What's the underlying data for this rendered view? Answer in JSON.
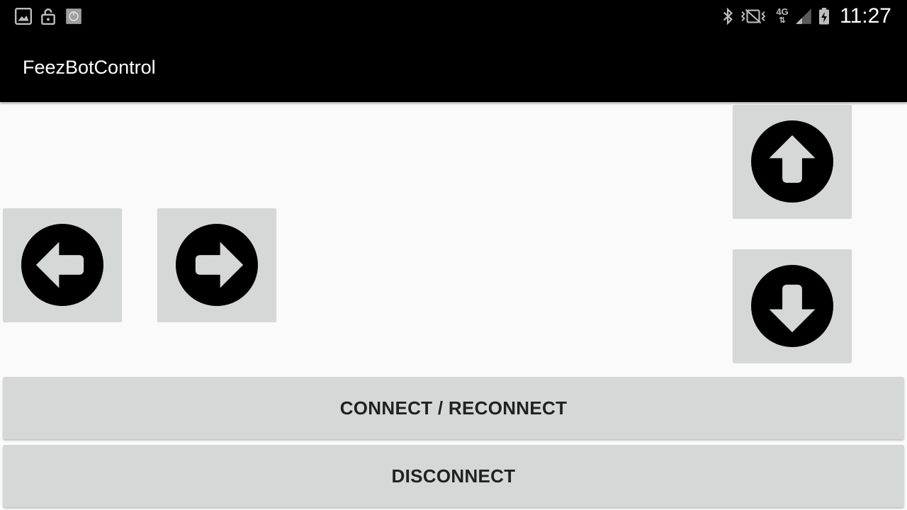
{
  "status_bar": {
    "time": "11:27",
    "network": "4G",
    "left_icons": [
      "gallery-icon",
      "lock-icon",
      "app-icon"
    ],
    "right_icons": [
      "bluetooth-icon",
      "vibrate-icon",
      "network-4g-icon",
      "signal-icon",
      "battery-charging-icon"
    ]
  },
  "app_bar": {
    "title": "FeezBotControl"
  },
  "controls": {
    "left_icon": "arrow-left-circle-icon",
    "right_icon": "arrow-right-circle-icon",
    "up_icon": "arrow-up-circle-icon",
    "down_icon": "arrow-down-circle-icon"
  },
  "buttons": {
    "connect_label": "CONNECT / RECONNECT",
    "disconnect_label": "DISCONNECT"
  },
  "colors": {
    "bar_background": "#000000",
    "page_background": "#fafafa",
    "button_background": "#d6d7d7",
    "button_text": "#212121"
  }
}
